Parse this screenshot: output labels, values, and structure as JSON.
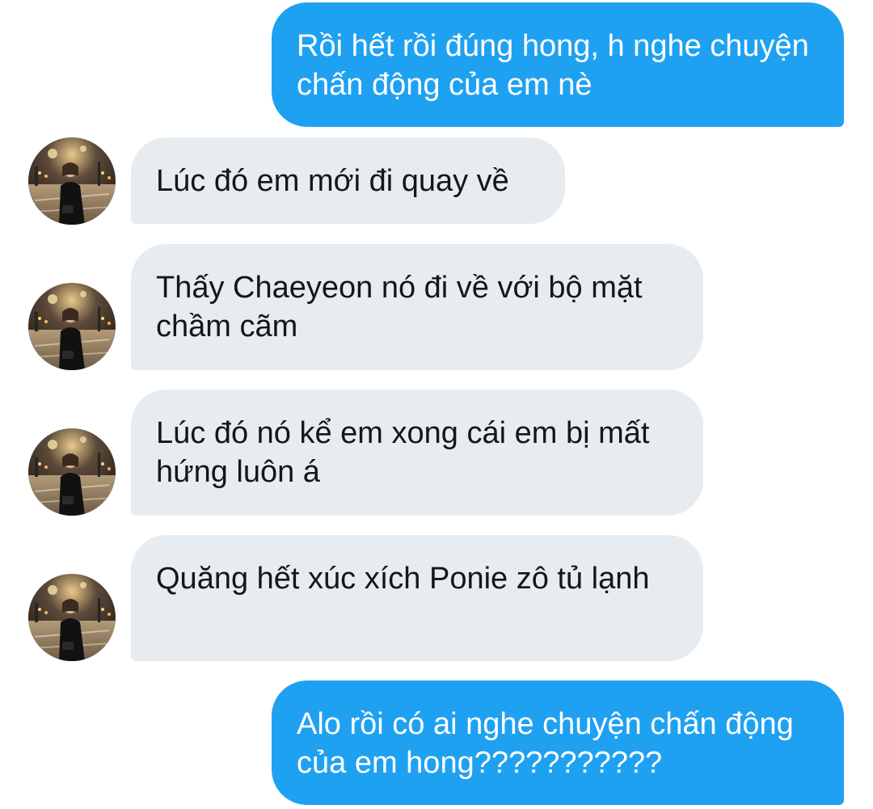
{
  "conversation": {
    "messages": [
      {
        "sender": "me",
        "text": "Rồi hết rồi đúng hong, h nghe chuyện chấn động của em nè"
      },
      {
        "sender": "contact",
        "text": "Lúc đó em mới đi quay về"
      },
      {
        "sender": "contact",
        "text": "Thấy Chaeyeon nó đi về với bộ mặt chầm cãm"
      },
      {
        "sender": "contact",
        "text": "Lúc đó nó kể em xong cái em bị mất hứng luôn á"
      },
      {
        "sender": "contact",
        "text": "Quăng hết xúc xích Ponie zô tủ lạnh"
      },
      {
        "sender": "me",
        "text": "Alo rồi có ai nghe chuyện chấn động của em hong???????????"
      }
    ]
  },
  "colors": {
    "sent_bubble": "#1fa1f2",
    "received_bubble": "#e6ecf0",
    "received_text": "#14171a"
  },
  "icons": {
    "avatar": "contact-photo-night-street"
  }
}
